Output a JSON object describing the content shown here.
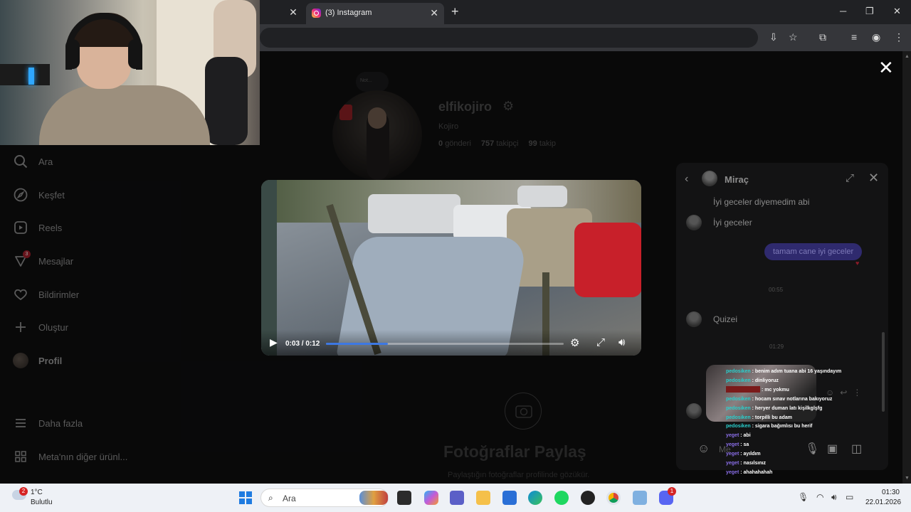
{
  "browser": {
    "tab_title": "(3) Instagram"
  },
  "sidebar": {
    "items": [
      {
        "label": "Ara",
        "icon": "search-icon"
      },
      {
        "label": "Keşfet",
        "icon": "compass-icon"
      },
      {
        "label": "Reels",
        "icon": "reels-icon"
      },
      {
        "label": "Mesajlar",
        "icon": "messenger-icon",
        "badge": "3"
      },
      {
        "label": "Bildirimler",
        "icon": "heart-icon"
      },
      {
        "label": "Oluştur",
        "icon": "plus-icon"
      },
      {
        "label": "Profil",
        "icon": "avatar"
      }
    ],
    "more_label": "Daha fazla",
    "meta_label": "Meta'nın diğer ürünl..."
  },
  "profile": {
    "note": "Not...",
    "username": "elfikojiro",
    "full_name": "Kojiro",
    "posts_count": "0",
    "posts_label": "gönderi",
    "followers_count": "757",
    "followers_label": "takipçi",
    "following_count": "99",
    "following_label": "takip",
    "share_title": "Fotoğraflar Paylaş",
    "share_subtitle": "Paylaştığın fotoğraflar profilinde gözükür."
  },
  "video": {
    "time": "0:03 / 0:12",
    "progress": 0.26
  },
  "chat": {
    "contact_name": "Miraç",
    "messages": [
      {
        "text": "İyi geceler diyemedim abi"
      },
      {
        "text": "İyi geceler"
      },
      {
        "text": "tamam cane iyi geceler"
      },
      {
        "text": "Quizei"
      }
    ],
    "timestamps": [
      "00:55",
      "01:29"
    ],
    "composer_placeholder": "Me"
  },
  "stream_chat": [
    {
      "user": "pedosiken",
      "text": "benim adım tuana abi 16 yaşındayım",
      "color": "#2ad0ce"
    },
    {
      "user": "pedosiken",
      "text": "dinliyoruz",
      "color": "#2ad0ce"
    },
    {
      "user": "",
      "text": "mc yokmu",
      "color": "#c83232"
    },
    {
      "user": "pedosiken",
      "text": "hocam sınav notlarına bakıyoruz",
      "color": "#2ad0ce"
    },
    {
      "user": "pedosiken",
      "text": "heryer duman latı kişilkglşfg",
      "color": "#2ad0ce"
    },
    {
      "user": "pedosiken",
      "text": "torpilli bu adam",
      "color": "#2ad0ce"
    },
    {
      "user": "pedosiken",
      "text": "sigara bağımlısı bu herif",
      "color": "#2ad0ce"
    },
    {
      "user": "yeget",
      "text": "abi",
      "color": "#8a6ee8"
    },
    {
      "user": "yeget",
      "text": "sa",
      "color": "#8a6ee8"
    },
    {
      "user": "yeget",
      "text": "ayıldım",
      "color": "#8a6ee8"
    },
    {
      "user": "yeget",
      "text": "nasılsınız",
      "color": "#8a6ee8"
    },
    {
      "user": "yeget",
      "text": "ahahahahah",
      "color": "#8a6ee8"
    }
  ],
  "taskbar": {
    "weather_badge": "2",
    "weather_temp": "1°C",
    "weather_desc": "Bulutlu",
    "search_placeholder": "Ara",
    "discord_badge": "1",
    "time": "01:30",
    "date": "22.01.2026"
  },
  "colors": {
    "accent_blue": "#3d78e3",
    "message_bubble": "#2f2a6e",
    "badge_red": "#d62424"
  }
}
